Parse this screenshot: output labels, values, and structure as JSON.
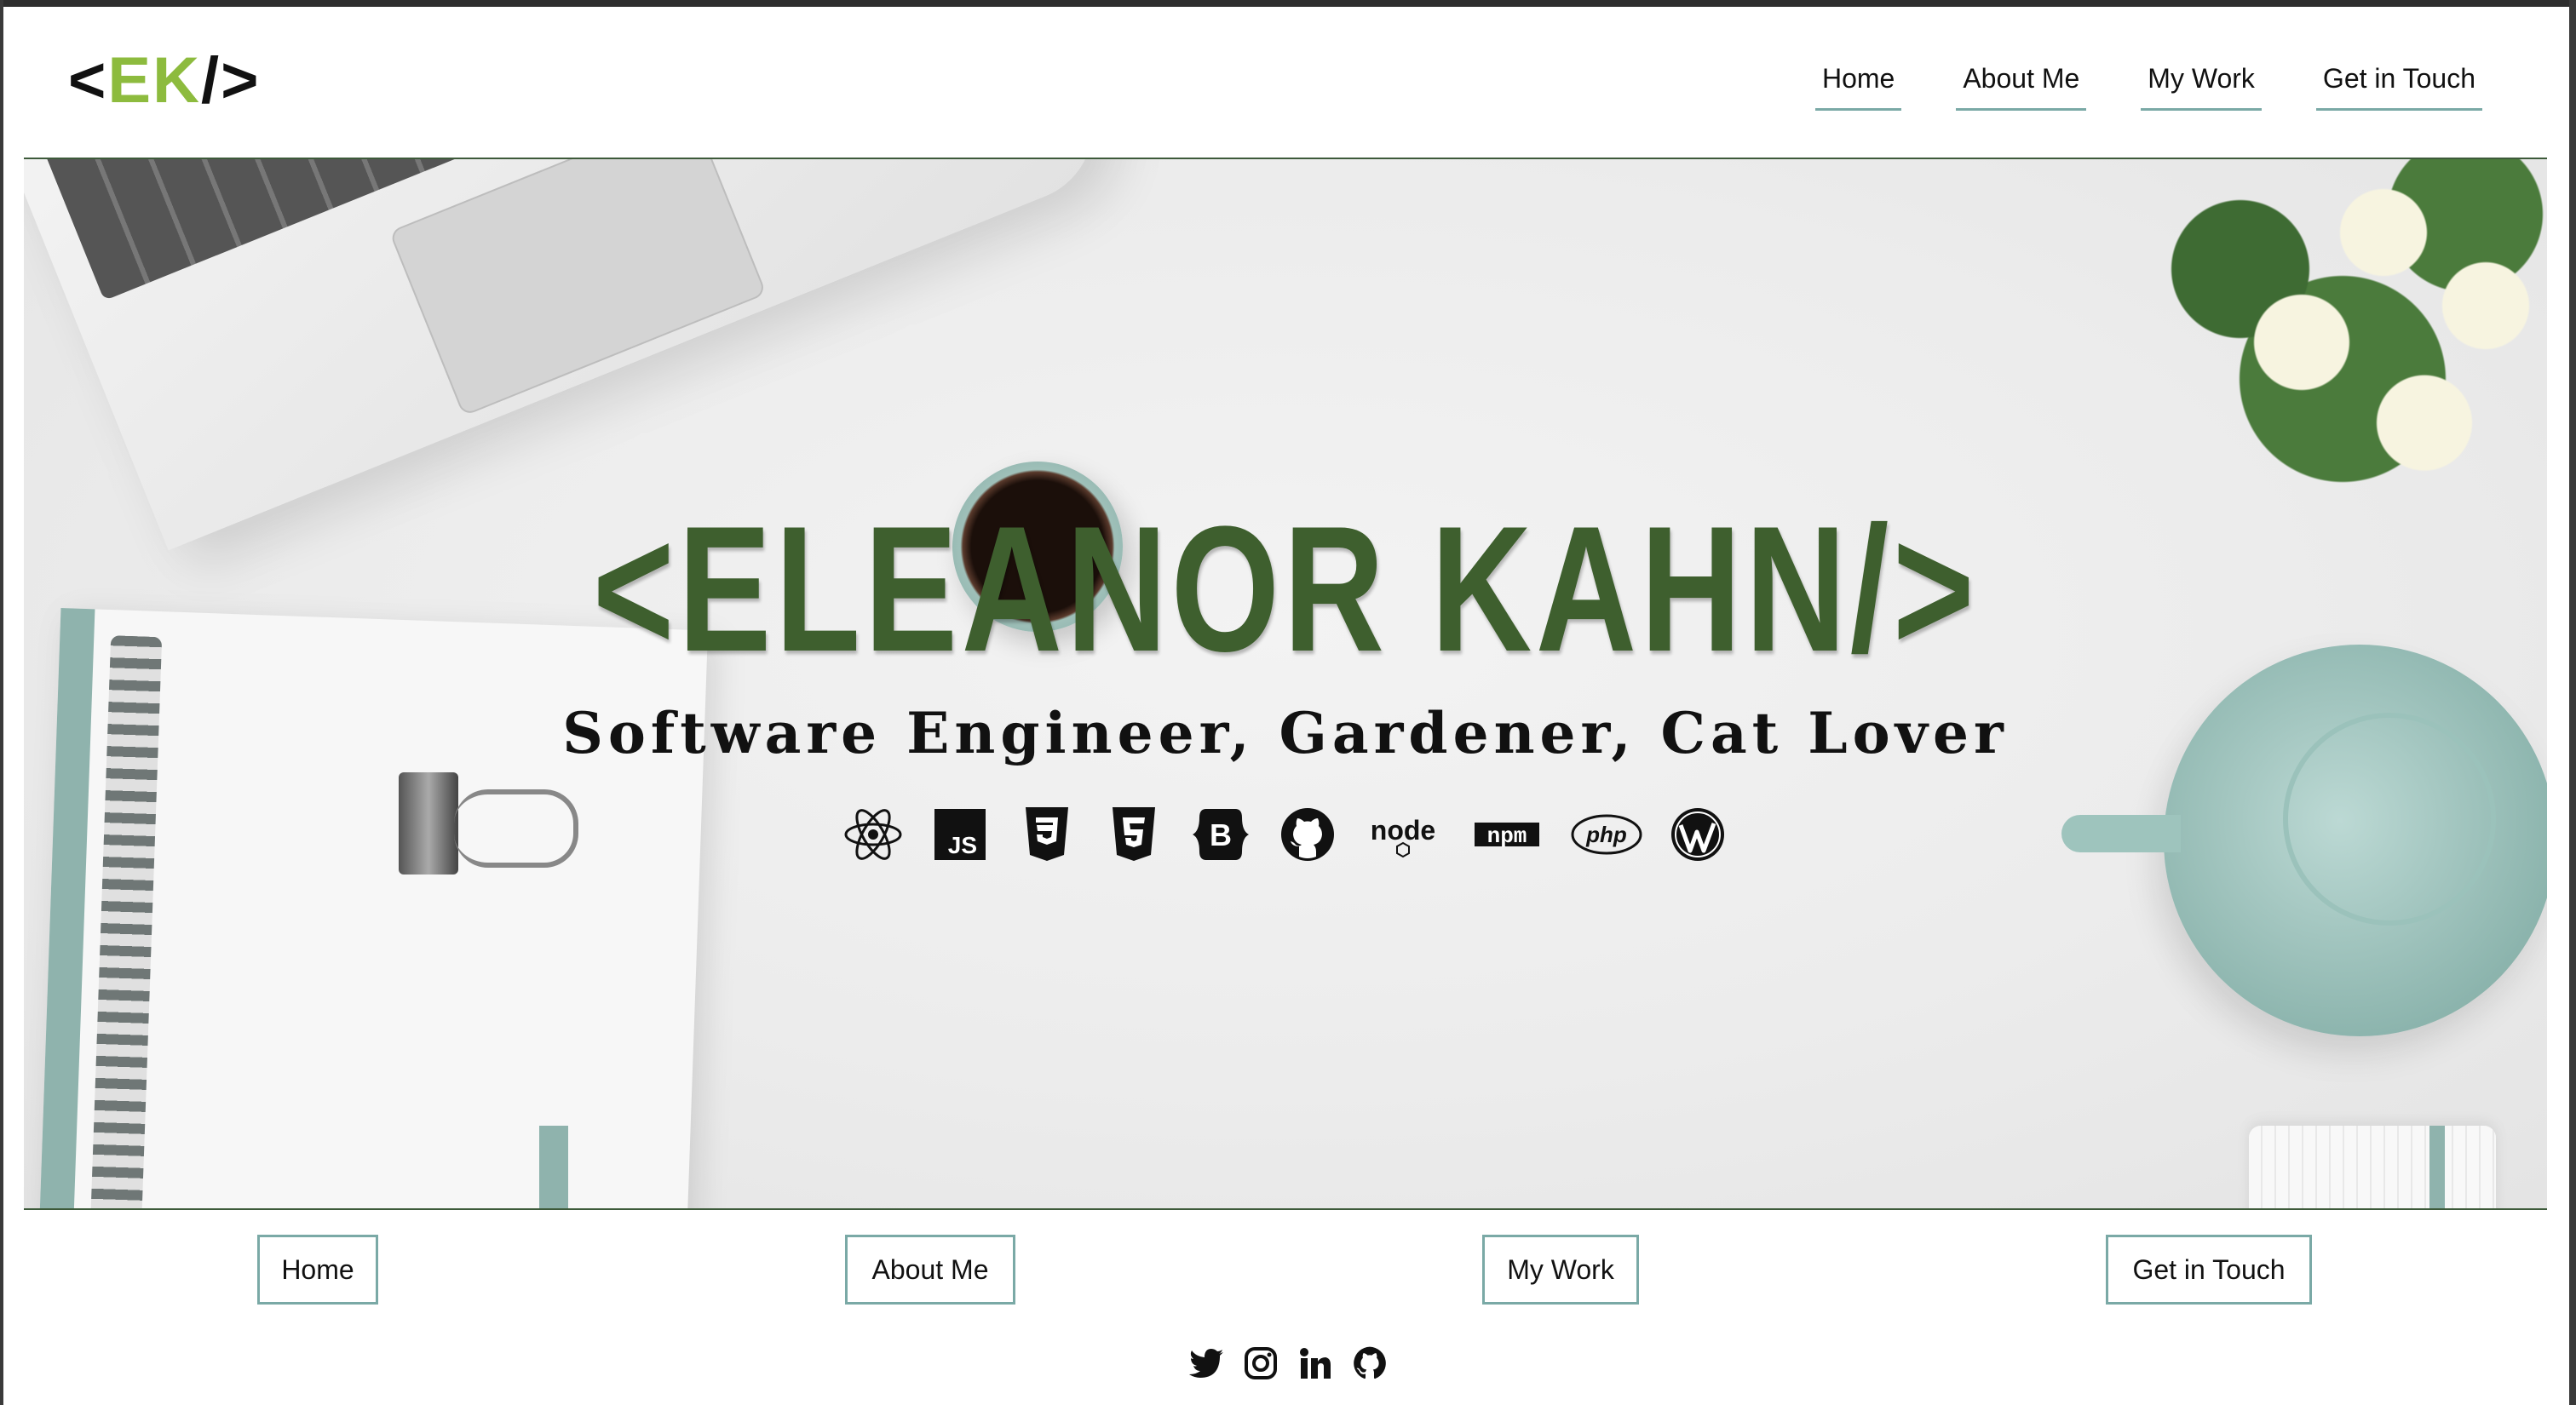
{
  "header": {
    "logo": {
      "open": "<",
      "initials": "EK",
      "close": "/>"
    },
    "nav": [
      {
        "label": "Home"
      },
      {
        "label": "About Me"
      },
      {
        "label": "My Work"
      },
      {
        "label": "Get in Touch"
      }
    ]
  },
  "hero": {
    "title": "<ELEANOR KAHN/>",
    "subtitle": "Software Engineer, Gardener, Cat Lover",
    "tech_icons": [
      "react-icon",
      "javascript-icon",
      "css3-icon",
      "html5-icon",
      "bootstrap-icon",
      "github-icon",
      "nodejs-icon",
      "npm-icon",
      "php-icon",
      "wordpress-icon"
    ],
    "tech_labels": {
      "js": "JS",
      "bootstrap": "B",
      "node": "node",
      "npm": "npm",
      "php": "php"
    }
  },
  "footer": {
    "buttons": [
      {
        "label": "Home"
      },
      {
        "label": "About Me"
      },
      {
        "label": "My Work"
      },
      {
        "label": "Get in Touch"
      }
    ],
    "social_icons": [
      "twitter-icon",
      "instagram-icon",
      "linkedin-icon",
      "github-icon"
    ]
  },
  "colors": {
    "accent_green": "#3e5f2e",
    "logo_green": "#8dbb3e",
    "border_teal": "#7aa9a6"
  }
}
